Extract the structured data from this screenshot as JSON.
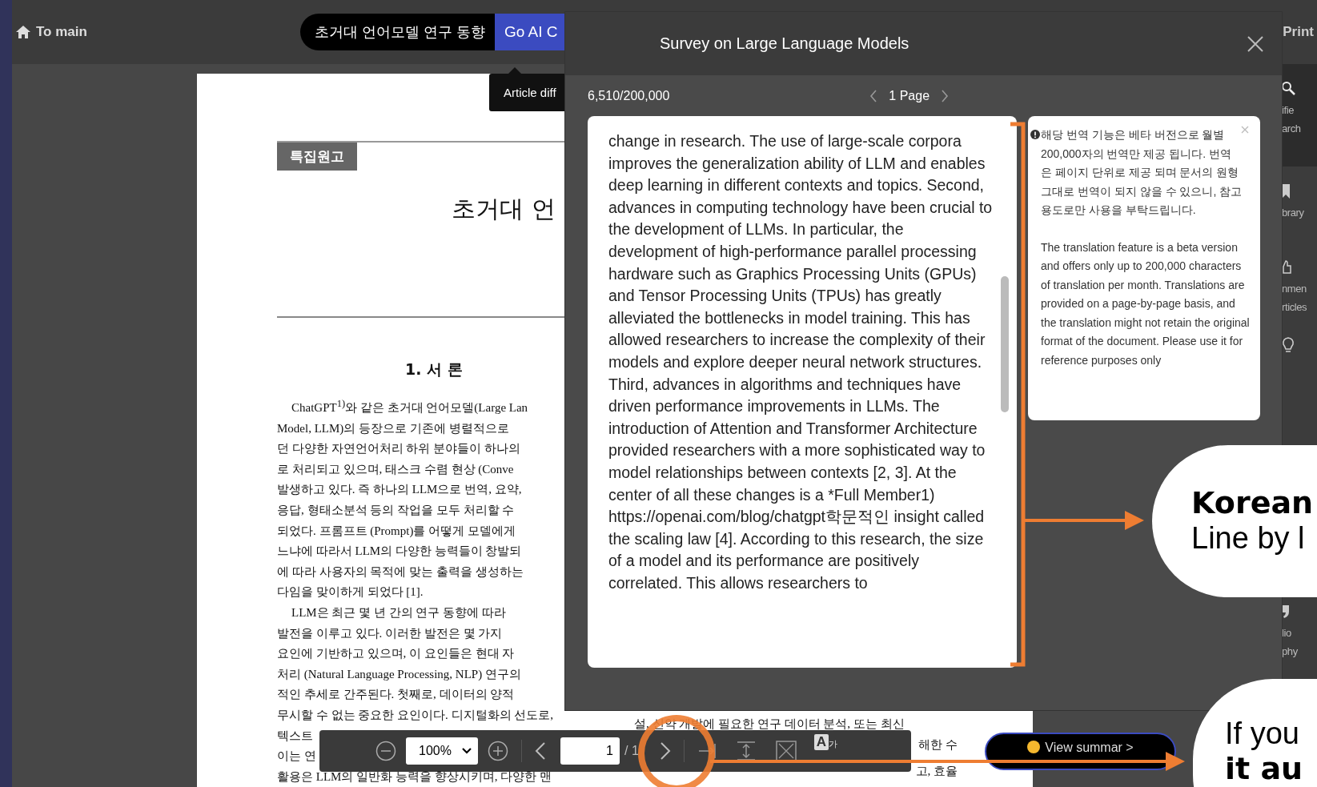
{
  "top_bar": {
    "home_link": "To main",
    "article_title": "초거대 언어모델 연구 동향",
    "ai_button": "Go AI C",
    "print_link": "Print"
  },
  "tooltip": "Article diff",
  "document": {
    "section_tag": "특집원고",
    "title": "초거대 언",
    "heading": "1. 서 론",
    "left_column_lines": [
      {
        "text": "ChatGPT$^{1)}$와 같은 초거대 언어모델(Large Lan",
        "indent": true
      },
      {
        "text": "Model, LLM)의 등장으로 기존에 병렬적으로",
        "indent": false
      },
      {
        "text": "던 다양한 자연언어처리 하위 분야들이 하나의",
        "indent": false
      },
      {
        "text": "로 처리되고 있으며, 태스크 수렴 현상 (Conve",
        "indent": false
      },
      {
        "text": "발생하고 있다. 즉 하나의 LLM으로 번역, 요약,",
        "indent": false
      },
      {
        "text": "응답, 형태소분석 등의 작업을 모두 처리할 수",
        "indent": false
      },
      {
        "text": "되었다. 프롬프트 (Prompt)를 어떻게 모델에게",
        "indent": false
      },
      {
        "text": "느냐에 따라서 LLM의 다양한 능력들이 창발되",
        "indent": false
      },
      {
        "text": "에 따라 사용자의 목적에 맞는 출력을 생성하는",
        "indent": false
      },
      {
        "text": "다임을 맞이하게 되었다 [1].",
        "indent": false
      },
      {
        "text": "LLM은 최근 몇 년 간의 연구 동향에 따라",
        "indent": true
      },
      {
        "text": "발전을 이루고 있다. 이러한 발전은 몇 가지",
        "indent": false
      },
      {
        "text": "요인에 기반하고 있으며, 이 요인들은 현대 자",
        "indent": false
      },
      {
        "text": "처리 (Natural Language Processing, NLP) 연구의",
        "indent": false
      },
      {
        "text": "적인 추세로 간주된다. 첫째로, 데이터의 양적",
        "indent": false
      },
      {
        "text": "무시할 수 없는 중요한 요인이다. 디지털화의 선도로,",
        "indent": false
      },
      {
        "text": "텍스트",
        "indent": false
      },
      {
        "text": "이는 연",
        "indent": false
      },
      {
        "text": "활용은 LLM의 일반화 능력을 향상시키며, 다양한 맨",
        "indent": false
      }
    ],
    "right_column_lines": [
      {
        "text": "설, 신약 개발에 필요한 연구 데이터 분석, 또는 최신"
      },
      {
        "text": "해한 수"
      },
      {
        "text": "고, 효율"
      }
    ]
  },
  "sidebar": {
    "items": [
      {
        "kind": "search",
        "label_lines": [
          "ifie",
          "arch"
        ]
      },
      {
        "kind": "bookmark",
        "label_lines": [
          "brary"
        ]
      },
      {
        "kind": "thumb",
        "label_lines": [
          "nmen",
          "rticles"
        ]
      },
      {
        "kind": "bulb"
      },
      {
        "kind": "quote",
        "label_lines": [
          "lio",
          "phy"
        ]
      }
    ]
  },
  "viewer_toolbar": {
    "zoom": "100%",
    "page_input": "1",
    "page_total": "/ 1",
    "translate_icon": [
      "A",
      "가"
    ]
  },
  "summary_button": "View summar >",
  "translation_modal": {
    "title": "Survey on Large Language Models",
    "usage": "6,510/200,000",
    "page": "1 Page",
    "paragraphs": [
      "change in research. The use of large-scale corpora improves the generalization ability of LLM and enables deep learning in different contexts and topics. Second, advances in computing technology have been crucial to the development of LLMs. In particular, the development of high-performance parallel processing hardware such as Graphics Processing Units (GPUs) and Tensor Processing Units (TPUs) has greatly alleviated the bottlenecks in model training. This has allowed researchers to increase the complexity of their models and explore deeper neural network structures. Third, advances in algorithms and techniques have driven performance improvements in LLMs. The introduction of Attention and Transformer Architecture provided researchers with a more sophisticated way to model relationships between contexts [2, 3]. At the center of all these changes is a *Full Member1)",
      "https://openai.com/blog/chatgpt학문적인 insight called the scaling law [4]. According to this research, the size of a model and its performance are positively correlated. This allows researchers to"
    ],
    "notice": {
      "korean": "해당 번역 기능은 베타 버전으로 월별 200,000자의 번역만 제공 됩니다. 번역은 페이지 단위로 제공 되며 문서의 원형 그대로 번역이 되지 않을 수 있으니, 참고용도로만 사용을 부탁드립니다.",
      "english": "The translation feature is a beta version and offers only up to 200,000 characters of translation per month. Translations are provided on a page-by-page basis, and the translation might not retain the original format of the document. Please use it for reference purposes only"
    }
  },
  "callouts": [
    {
      "kind": "bold-first",
      "bold": "Korean",
      "light": "Line by l"
    },
    {
      "kind": "light-first",
      "light": "If you",
      "bold": "it au"
    }
  ]
}
